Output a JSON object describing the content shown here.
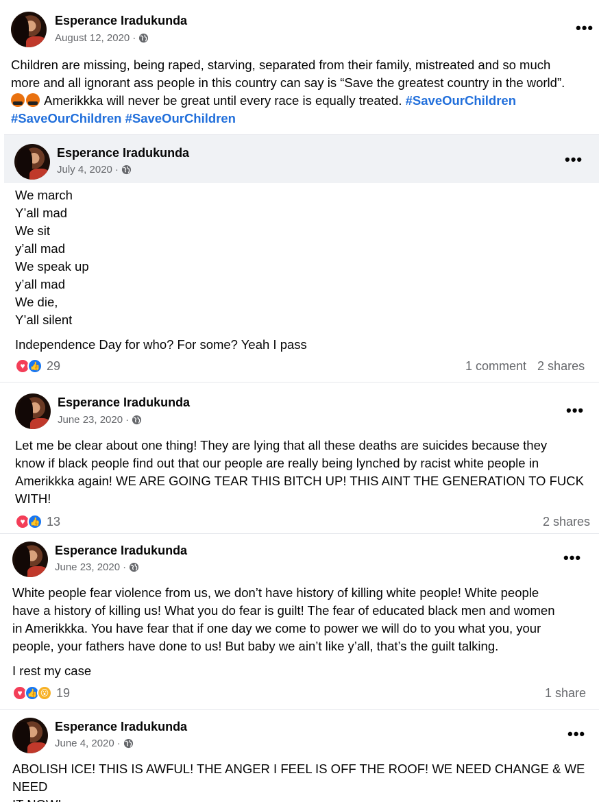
{
  "posts": [
    {
      "author": "Esperance Iradukunda",
      "date": "August 12, 2020",
      "text_line1": "Children are missing, being raped, starving, separated from their family, mistreated and so much",
      "text_line2": "more and all ignorant ass people in this country can say is “Save the greatest country in the world”.",
      "text_line3": " Amerikkka will never be great until every race is equally treated. ",
      "hashtag1": "#SaveOurChildren",
      "hashtag2": "#SaveOurChildren",
      "hashtag3": "#SaveOurChildren",
      "more_icon": "more-horizontal-icon"
    },
    {
      "author": "Esperance Iradukunda",
      "date": "July 4, 2020",
      "lines": [
        "We march",
        "Y’all mad",
        "We sit",
        "y’all mad",
        "We speak up",
        "y’all mad",
        "We die,",
        "Y’all silent"
      ],
      "closing": "Independence Day for who? For some? Yeah I pass",
      "reaction_count": "29",
      "comments": "1 comment",
      "shares": "2 shares"
    },
    {
      "author": "Esperance Iradukunda",
      "date": "June 23, 2020",
      "lines": [
        "Let me be clear about one thing! They are lying that all these deaths are suicides because they",
        "know if black people find out that our people are really being lynched by racist white people in",
        "Amerikkka again! WE ARE GOING TEAR THIS BITCH UP! THIS AINT THE GENERATION TO FUCK",
        "WITH!"
      ],
      "reaction_count": "13",
      "shares": "2 shares"
    },
    {
      "author": "Esperance Iradukunda",
      "date": "June 23, 2020",
      "lines": [
        "White people fear violence from us, we don’t have history of killing white people! White people",
        "have a history of killing us! What you do fear is guilt! The fear of educated black men and women",
        "in Amerikkka. You have fear that if one day we come to power we will do to you what you, your",
        "people, your fathers have done to us! But baby we ain’t like y’all, that’s the guilt talking."
      ],
      "closing": "I rest my case",
      "reaction_count": "19",
      "shares": "1 share"
    },
    {
      "author": "Esperance Iradukunda",
      "date": "June 4, 2020",
      "lines": [
        "ABOLISH ICE! THIS IS AWFUL! THE ANGER I FEEL IS OFF THE ROOF! WE NEED CHANGE & WE NEED",
        "IT NOW!"
      ]
    }
  ],
  "colors": {
    "hashtag": "#216fdb",
    "meta": "#65676b",
    "love": "#f33e58",
    "like": "#1877f2",
    "wow": "#f7b125",
    "shared_bg": "#f0f2f5"
  }
}
